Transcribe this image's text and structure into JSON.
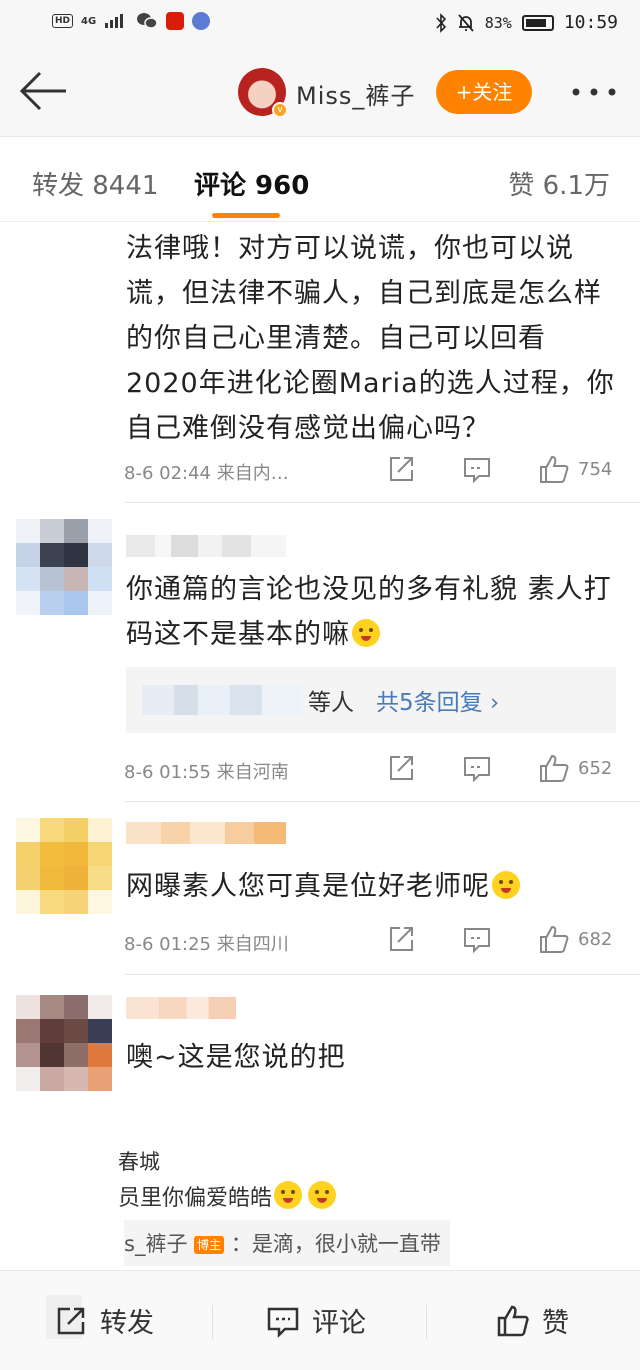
{
  "status_bar": {
    "left": {
      "hd": "HD",
      "network": "4G"
    },
    "battery": "83%",
    "time": "10:59"
  },
  "header": {
    "username": "Miss_裤子",
    "follow_label": "+关注"
  },
  "tabs": {
    "forward": "转发 8441",
    "comments": "评论 960",
    "likes": "赞 6.1万"
  },
  "comments": [
    {
      "text": "法律哦！对方可以说谎，你也可以说谎，但法律不骗人，自己到底是怎么样的你自己心里清楚。自己可以回看2020年进化论圈Maria的选人过程，你自己难倒没有感觉出偏心吗？",
      "meta": "8-6 02:44 来自内…",
      "likes": "754"
    },
    {
      "text": "你通篇的言论也没见的多有礼貌 素人打码这不是基本的嘛",
      "replies": {
        "suffix": "等人",
        "link": "共5条回复 ›"
      },
      "meta": "8-6 01:55 来自河南",
      "likes": "652"
    },
    {
      "text": "网曝素人您可真是位好老师呢",
      "meta": "8-6 01:25 来自四川",
      "likes": "682"
    },
    {
      "text": "噢~这是您说的把"
    }
  ],
  "floating": {
    "line1": "春城",
    "line2": "员里你偏爱皓皓",
    "quote_name": "s_裤子",
    "quote_badge": "博主",
    "quote_text": "：是滴，很小就一直带"
  },
  "bottom_bar": {
    "forward": "转发",
    "comment": "评论",
    "like": "赞"
  },
  "colors": {
    "accent": "#ff8200",
    "link": "#4a7ab8",
    "muted": "#888888"
  }
}
